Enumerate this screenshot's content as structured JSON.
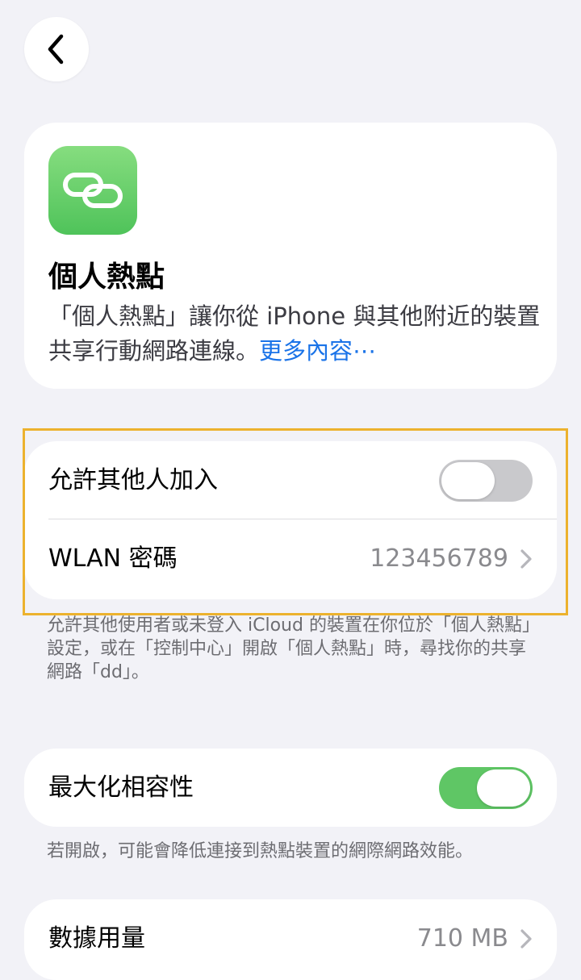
{
  "intro": {
    "title": "個人熱點",
    "description": "「個人熱點」讓你從 iPhone 與其他附近的裝置共享行動網路連線。",
    "more_link": "更多內容⋯"
  },
  "sharing": {
    "allow_others_label": "允許其他人加入",
    "allow_others_state": "off",
    "password_label": "WLAN 密碼",
    "password_value": "123456789",
    "footnote": "允許其他使用者或未登入 iCloud 的裝置在你位於「個人熱點」設定，或在「控制中心」開啟「個人熱點」時，尋找你的共享網路「dd」。"
  },
  "compatibility": {
    "label": "最大化相容性",
    "state": "on",
    "footnote": "若開啟，可能會降低連接到熱點裝置的網際網路效能。"
  },
  "data_usage": {
    "label": "數據用量",
    "value": "710 MB"
  },
  "colors": {
    "background": "#f2f2f7",
    "toggle_on": "#5fc665",
    "toggle_off": "#c9c9cc",
    "link": "#1a73e8",
    "highlight": "#ecb22e",
    "icon": "#5cc864"
  },
  "icons": {
    "back": "chevron-left-icon",
    "hotspot": "link-chain-icon",
    "disclosure": "chevron-right-icon"
  }
}
